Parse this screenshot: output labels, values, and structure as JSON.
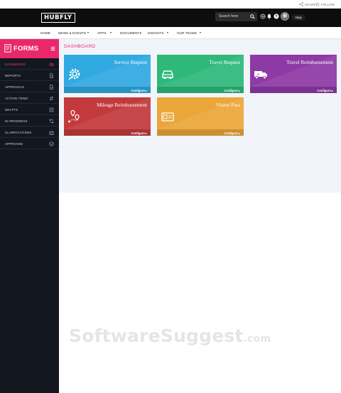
{
  "topbar": {
    "share_label": "SHARE",
    "follow_label": "FOLLOW"
  },
  "header": {
    "logo_text": "HUBFLY",
    "search_placeholder": "Search here",
    "user_name": "Vijay"
  },
  "nav": {
    "items": [
      {
        "label": "HOME"
      },
      {
        "label": "NEWS & EVENTS"
      },
      {
        "label": "APPS"
      },
      {
        "label": "DOCUMENTS"
      },
      {
        "label": "INSIGHTS"
      },
      {
        "label": "OUR TEAMS"
      }
    ]
  },
  "sidebar": {
    "title": "FORMS",
    "items": [
      {
        "label": "DASHBOARD",
        "icon": "dashboard-icon",
        "active": true
      },
      {
        "label": "REPORTS",
        "icon": "report-icon"
      },
      {
        "label": "APPROVALS",
        "icon": "approvals-icon"
      },
      {
        "label": "ACTION ITEMS",
        "icon": "transfer-icon"
      },
      {
        "label": "DRAFTS",
        "icon": "draft-icon"
      },
      {
        "label": "IN PROGRESS",
        "icon": "refresh-icon"
      },
      {
        "label": "CLARIFICATIONS",
        "icon": "crown-icon"
      },
      {
        "label": "APPROVED",
        "icon": "check-circle-icon"
      }
    ]
  },
  "main": {
    "title": "DASHBOARD",
    "tiles": [
      {
        "title": "Service Request",
        "configure": "Configure ▸",
        "color": "#31a9e1",
        "icon": "gear-icon"
      },
      {
        "title": "Travel Request",
        "configure": "Configure ▸",
        "color": "#2eb87a",
        "icon": "car-icon"
      },
      {
        "title": "Travel Reimbursement",
        "configure": "Configure ▸",
        "color": "#8e3aa6",
        "icon": "truck-icon"
      },
      {
        "title": "Mileage Reimbursement",
        "configure": "Configure ▸",
        "color": "#c33a3d",
        "icon": "map-pin-icon"
      },
      {
        "title": "Visitor Pass",
        "configure": "Configure ▸",
        "color": "#eba63a",
        "icon": "pass-icon"
      }
    ]
  },
  "watermark": {
    "brand": "SoftwareSuggest",
    "suffix": ".com"
  }
}
